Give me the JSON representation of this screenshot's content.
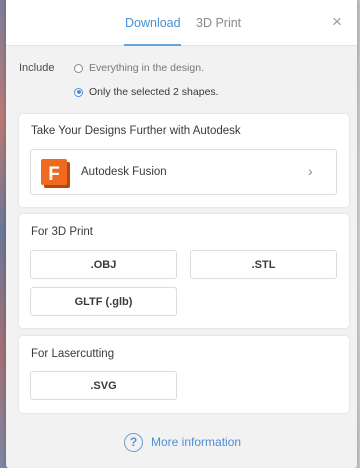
{
  "tabs": [
    {
      "label": "Download",
      "active": true
    },
    {
      "label": "3D Print",
      "active": false
    }
  ],
  "close_glyph": "×",
  "include": {
    "label": "Include",
    "options": [
      {
        "label": "Everything in the design.",
        "checked": false
      },
      {
        "label": "Only the selected 2 shapes.",
        "checked": true
      }
    ]
  },
  "autodesk_section": {
    "title": "Take Your Designs Further with Autodesk",
    "fusion": {
      "logo_letter": "F",
      "label": "Autodesk Fusion",
      "chevron": "›",
      "icon": "autodesk-fusion-logo"
    }
  },
  "print_section": {
    "title": "For 3D Print",
    "formats": [
      ".OBJ",
      ".STL",
      "GLTF (.glb)"
    ]
  },
  "laser_section": {
    "title": "For Lasercutting",
    "formats": [
      ".SVG"
    ]
  },
  "more_info": {
    "icon_glyph": "?",
    "label": "More information",
    "icon": "help-circle-icon"
  },
  "colors": {
    "accent": "#4b8fd6",
    "fusion_orange": "#ef6a1f"
  }
}
